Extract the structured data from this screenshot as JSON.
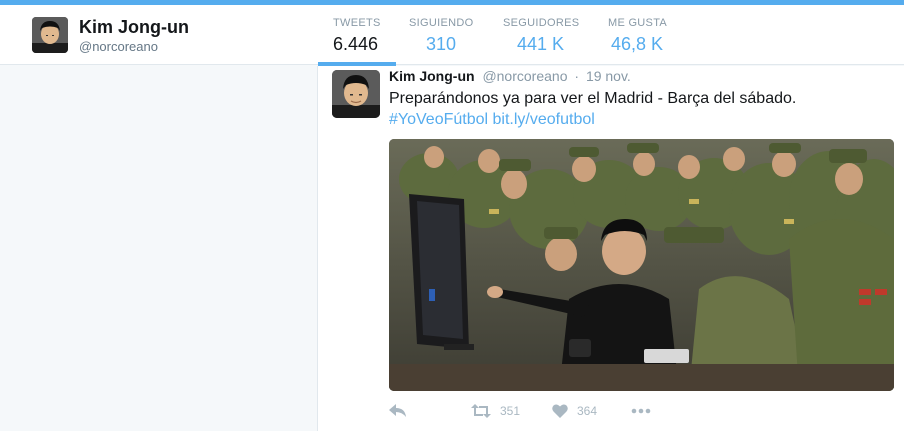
{
  "profile": {
    "name": "Kim Jong-un",
    "handle": "@norcoreano"
  },
  "stats": [
    {
      "label": "TWEETS",
      "value": "6.446",
      "active": true
    },
    {
      "label": "SIGUIENDO",
      "value": "310",
      "active": false
    },
    {
      "label": "SEGUIDORES",
      "value": "441 K",
      "active": false
    },
    {
      "label": "ME GUSTA",
      "value": "46,8 K",
      "active": false
    }
  ],
  "tweet": {
    "name": "Kim Jong-un",
    "handle": "@norcoreano",
    "separator": "·",
    "time": "19 nov.",
    "text": "Preparándonos ya para ver el Madrid - Barça del sábado.",
    "hashtag": "#YoVeoFútbol",
    "link": "bit.ly/veofutbol",
    "actions": {
      "reply_icon": "reply-icon",
      "retweet_icon": "retweet-icon",
      "retweet_count": "351",
      "like_icon": "heart-icon",
      "like_count": "364",
      "more_icon": "more-icon"
    }
  },
  "colors": {
    "accent": "#55acee",
    "text_dark": "#14171a",
    "muted": "#8899a6",
    "background": "#f5f8fa"
  }
}
